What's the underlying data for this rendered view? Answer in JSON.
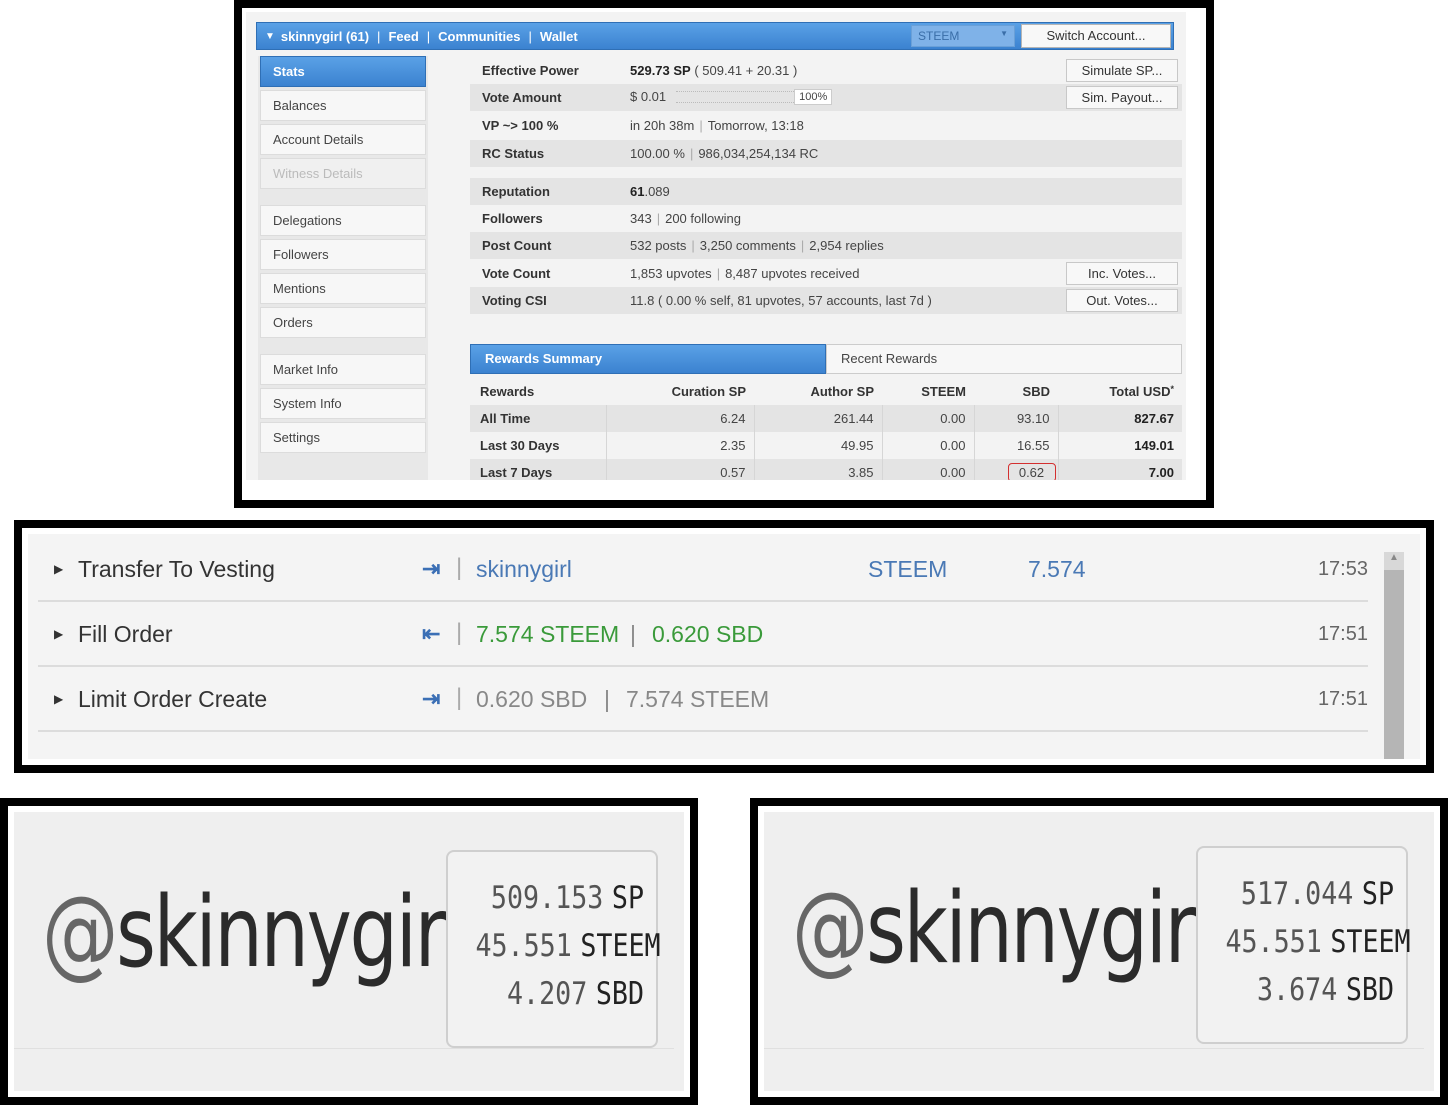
{
  "steemworld": {
    "header": {
      "account": "skinnygirl (61)",
      "nav": [
        "Feed",
        "Communities",
        "Wallet"
      ],
      "token_select": "STEEM",
      "switch_button": "Switch Account..."
    },
    "sidebar": [
      "Stats",
      "Balances",
      "Account Details",
      "Witness Details",
      "Delegations",
      "Followers",
      "Mentions",
      "Orders",
      "Market Info",
      "System Info",
      "Settings"
    ],
    "stats": {
      "effective_power": {
        "label": "Effective Power",
        "main": "529.73 SP",
        "detail": "( 509.41 + 20.31 )",
        "button": "Simulate SP..."
      },
      "vote_amount": {
        "label": "Vote Amount",
        "value": "$ 0.01",
        "percent": "100%",
        "button": "Sim. Payout..."
      },
      "vp": {
        "label": "VP ~> 100 %",
        "a": "in 20h 38m",
        "b": "Tomorrow, 13:18"
      },
      "rc": {
        "label": "RC Status",
        "a": "100.00 %",
        "b": "986,034,254,134 RC"
      },
      "reputation": {
        "label": "Reputation",
        "int": "61",
        "dec": ".089"
      },
      "followers": {
        "label": "Followers",
        "a": "343",
        "b": "200 following"
      },
      "post_count": {
        "label": "Post Count",
        "a": "532 posts",
        "b": "3,250 comments",
        "c": "2,954 replies"
      },
      "vote_count": {
        "label": "Vote Count",
        "a": "1,853 upvotes",
        "b": "8,487 upvotes received",
        "button": "Inc. Votes..."
      },
      "voting_csi": {
        "label": "Voting CSI",
        "value": "11.8 ( 0.00 % self, 81 upvotes, 57 accounts, last 7d )",
        "button": "Out. Votes..."
      }
    },
    "tabs": [
      "Rewards Summary",
      "Recent Rewards"
    ],
    "rewards": {
      "headers": [
        "Rewards",
        "Curation SP",
        "Author SP",
        "STEEM",
        "SBD",
        "Total USD"
      ],
      "rows": [
        [
          "All Time",
          "6.24",
          "261.44",
          "0.00",
          "93.10",
          "827.67"
        ],
        [
          "Last 30 Days",
          "2.35",
          "49.95",
          "0.00",
          "16.55",
          "149.01"
        ],
        [
          "Last 7 Days",
          "0.57",
          "3.85",
          "0.00",
          "0.62",
          "7.00"
        ]
      ],
      "total_usd_mark": "*"
    }
  },
  "operations": [
    {
      "name": "Transfer To Vesting",
      "icon": "enter-arrow-icon",
      "field1": "skinnygirl",
      "field2": "STEEM",
      "field3": "7.574",
      "time": "17:53"
    },
    {
      "name": "Fill Order",
      "icon": "exit-arrow-icon",
      "field1": "7.574 STEEM",
      "field2": "0.620 SBD",
      "time": "17:51"
    },
    {
      "name": "Limit Order Create",
      "icon": "enter-arrow-icon",
      "field1": "0.620 SBD",
      "field2": "7.574 STEEM",
      "time": "17:51"
    }
  ],
  "balance_before": {
    "handle_at": "@",
    "handle_name": "skinnygirl",
    "rows": [
      {
        "int": "509",
        "dec": ".153",
        "unit": "SP"
      },
      {
        "int": "45",
        "dec": ".551",
        "unit": "STEEM"
      },
      {
        "int": "4",
        "dec": ".207",
        "unit": "SBD"
      }
    ]
  },
  "balance_after": {
    "handle_at": "@",
    "handle_name": "skinnygirl",
    "rows": [
      {
        "int": "517",
        "dec": ".044",
        "unit": "SP"
      },
      {
        "int": "45",
        "dec": ".551",
        "unit": "STEEM"
      },
      {
        "int": "3",
        "dec": ".674",
        "unit": "SBD"
      }
    ]
  },
  "colors": {
    "accent_blue": "#3b82d0",
    "green": "#3a9a3a",
    "highlight_red": "#d32f2f"
  }
}
